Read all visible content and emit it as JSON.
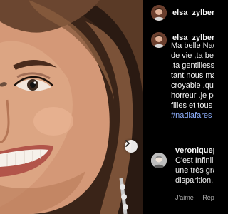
{
  "post": {
    "author_username": "elsa_zylbers",
    "caption_lines": [
      "Ma belle Nad",
      "de vie ,ta bea",
      ",ta gentillesse",
      "tant nous ma",
      "croyable .que",
      "horreur .je pe",
      "filles et tous c"
    ],
    "hashtag": "#nadiafares",
    "next_icon": "chevron-right-icon"
  },
  "comment": {
    "username": "veroniquepa",
    "lines": [
      "C'est Infiniiiii",
      "une très gran",
      "disparition. C"
    ],
    "like_label": "J'aime",
    "reply_label": "Répo"
  },
  "colors": {
    "background": "#000000",
    "text": "#f5f5f5",
    "hashtag": "#8fb1ff",
    "muted": "#a8a8a8"
  }
}
